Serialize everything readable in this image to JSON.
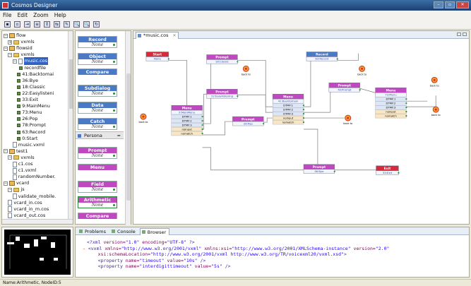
{
  "window": {
    "title": "Cosmos Designer",
    "buttons": [
      "–",
      "▫",
      "✕"
    ]
  },
  "menu": [
    "File",
    "Edit",
    "Zoom",
    "Help"
  ],
  "toolbar": [
    "▪",
    "▫",
    "⇥",
    "≡",
    "↕",
    "⇆",
    "✎",
    "🔍",
    "🔍",
    "↻"
  ],
  "navigator": {
    "rows": [
      {
        "label": "flow",
        "indent": 0,
        "kind": "project",
        "toggle": "−"
      },
      {
        "label": "vxmls",
        "indent": 2,
        "kind": "folder",
        "toggle": "+"
      },
      {
        "label": "flowsid",
        "indent": 0,
        "kind": "project",
        "toggle": "−"
      },
      {
        "label": "vxmls",
        "indent": 2,
        "kind": "folder",
        "toggle": "−"
      },
      {
        "label": "music.cos",
        "indent": 4,
        "kind": "file",
        "toggle": "−",
        "selected": true
      },
      {
        "label": "recordfile",
        "indent": 7,
        "kind": "node",
        "toggle": ""
      },
      {
        "label": "41:Backtomai",
        "indent": 6,
        "kind": "node",
        "toggle": ""
      },
      {
        "label": "36:Bye",
        "indent": 6,
        "kind": "node",
        "toggle": ""
      },
      {
        "label": "18:Classic",
        "indent": 6,
        "kind": "node",
        "toggle": ""
      },
      {
        "label": "22:Easylisteni",
        "indent": 6,
        "kind": "node",
        "toggle": ""
      },
      {
        "label": "33:Exit",
        "indent": 6,
        "kind": "node",
        "toggle": ""
      },
      {
        "label": "9:MainMenu",
        "indent": 6,
        "kind": "node",
        "toggle": ""
      },
      {
        "label": "73:Menu",
        "indent": 6,
        "kind": "node",
        "toggle": ""
      },
      {
        "label": "26:Pop",
        "indent": 6,
        "kind": "node",
        "toggle": ""
      },
      {
        "label": "78:Prompt",
        "indent": 6,
        "kind": "node",
        "toggle": ""
      },
      {
        "label": "63:Record",
        "indent": 6,
        "kind": "node",
        "toggle": ""
      },
      {
        "label": "0:Start",
        "indent": 6,
        "kind": "node",
        "toggle": ""
      },
      {
        "label": "music.vxml",
        "indent": 4,
        "kind": "file",
        "toggle": ""
      },
      {
        "label": "test1",
        "indent": 0,
        "kind": "project",
        "toggle": "−"
      },
      {
        "label": "vxmls",
        "indent": 2,
        "kind": "folder",
        "toggle": "−"
      },
      {
        "label": "c1.cos",
        "indent": 4,
        "kind": "file",
        "toggle": ""
      },
      {
        "label": "c1.vxml",
        "indent": 4,
        "kind": "file",
        "toggle": ""
      },
      {
        "label": "randomNumber.",
        "indent": 4,
        "kind": "file",
        "toggle": ""
      },
      {
        "label": "vcard",
        "indent": 0,
        "kind": "project",
        "toggle": "−"
      },
      {
        "label": "js",
        "indent": 2,
        "kind": "folder",
        "toggle": "−"
      },
      {
        "label": "validate_mobile.",
        "indent": 4,
        "kind": "file",
        "toggle": ""
      },
      {
        "label": "vcard_in.cos",
        "indent": 2,
        "kind": "file",
        "toggle": ""
      },
      {
        "label": "vcard_in_m.cos",
        "indent": 2,
        "kind": "file",
        "toggle": ""
      },
      {
        "label": "vcard_out.cos",
        "indent": 2,
        "kind": "file",
        "toggle": ""
      }
    ]
  },
  "palette": {
    "items": [
      {
        "label": "Record",
        "sub": "None",
        "color": "blue"
      },
      {
        "label": "Object",
        "sub": "None",
        "color": "blue"
      },
      {
        "label": "Compare",
        "sub": "",
        "color": "blue"
      },
      {
        "label": "Subdialog",
        "sub": "None",
        "color": "blue"
      },
      {
        "label": "Data",
        "sub": "None",
        "color": "blue"
      },
      {
        "label": "Catch",
        "sub": "None",
        "color": "blue"
      },
      {
        "label": "Prompt",
        "sub": "None",
        "color": "pink"
      },
      {
        "label": "Menu",
        "sub": "",
        "color": "pink"
      },
      {
        "label": "Field",
        "sub": "None",
        "color": "pink"
      },
      {
        "label": "Arithmetic",
        "sub": "None",
        "color": "pink",
        "highlight": true
      },
      {
        "label": "Compare",
        "sub": "",
        "color": "pink"
      }
    ],
    "persona_label": "Persona",
    "persona_toggle": "≈"
  },
  "editor": {
    "tab_label": "*music.cos",
    "tab_close": "✕",
    "nodes": [
      {
        "id": "start",
        "title": "Start",
        "sub": "None",
        "color": "#d92a3a",
        "rows": []
      },
      {
        "id": "mainmenu",
        "title": "Menu",
        "sub": "9:MainMenu",
        "color": "#c048c0",
        "rows": [
          "DTMF:1",
          "DTMF:2",
          "DTMF:3",
          "noinput",
          "nomatch"
        ]
      },
      {
        "id": "classic",
        "title": "Prompt",
        "sub": "18:Classic",
        "color": "#c048c0",
        "rows": []
      },
      {
        "id": "easylisten",
        "title": "Prompt",
        "sub": "22:Easylistening",
        "color": "#c048c0",
        "rows": []
      },
      {
        "id": "pop",
        "title": "Prompt",
        "sub": "26:Pop",
        "color": "#c048c0",
        "rows": []
      },
      {
        "id": "backtomain",
        "title": "Menu",
        "sub": "41:Backtomain",
        "color": "#c048c0",
        "rows": [
          "DTMF:1",
          "DTMF:2",
          "DTMF:3",
          "noinput",
          "nomatch"
        ]
      },
      {
        "id": "record",
        "title": "Record",
        "sub": "63:Record",
        "color": "#4a79c5",
        "rows": []
      },
      {
        "id": "prompt78",
        "title": "Prompt",
        "sub": "78:Prompt",
        "color": "#c048c0",
        "rows": []
      },
      {
        "id": "menu73",
        "title": "Menu",
        "sub": "73:Menu",
        "color": "#c048c0",
        "rows": [
          "DTMF:1",
          "DTMF:2",
          "DTMF:3",
          "noinput",
          "nomatch"
        ]
      },
      {
        "id": "bye",
        "title": "Prompt",
        "sub": "36:Bye",
        "color": "#c048c0",
        "rows": []
      },
      {
        "id": "exit",
        "title": "Exit",
        "sub": "33:Exit",
        "color": "#d92a3a",
        "rows": []
      }
    ],
    "node_sub_default": "None",
    "terminal_label": "back to"
  },
  "bottom": {
    "tabs": [
      "Problems",
      "Console",
      "Browser"
    ],
    "active_tab": "Browser",
    "code_lines": [
      {
        "tokens": [
          [
            "t",
            "<?xml "
          ],
          [
            "a",
            "version="
          ],
          [
            "v",
            "\"1.0\" "
          ],
          [
            "a",
            "encoding="
          ],
          [
            "v",
            "\"UTF-8\" "
          ],
          [
            "t",
            "?>"
          ]
        ]
      },
      {
        "marker": "-",
        "tokens": [
          [
            "t",
            "<vxml "
          ],
          [
            "a",
            "xmlns="
          ],
          [
            "v",
            "\"http://www.w3.org/2001/vxml\" "
          ],
          [
            "a",
            "xmlns:xsi="
          ],
          [
            "v",
            "\"http://www.w3.org/2001/XMLSchema-instance\" "
          ],
          [
            "a",
            "version="
          ],
          [
            "v",
            "\"2.0\""
          ]
        ]
      },
      {
        "tokens": [
          [
            "a",
            "    xsi:schemaLocation="
          ],
          [
            "v",
            "\"http://www.w3.org/2001/vxml http://www.w3.org/TR/voicexml20/vxml.xsd\""
          ],
          [
            "t",
            ">"
          ]
        ]
      },
      {
        "tokens": [
          [
            "t",
            "    <property "
          ],
          [
            "a",
            "name="
          ],
          [
            "v",
            "\"timeout\" "
          ],
          [
            "a",
            "value="
          ],
          [
            "v",
            "\"10s\" "
          ],
          [
            "t",
            "/>"
          ]
        ]
      },
      {
        "tokens": [
          [
            "t",
            "    <property "
          ],
          [
            "a",
            "name="
          ],
          [
            "v",
            "\"interdigittimeout\" "
          ],
          [
            "a",
            "value="
          ],
          [
            "v",
            "\"5s\" "
          ],
          [
            "t",
            "/>"
          ]
        ]
      }
    ]
  },
  "status": {
    "text": "Name:Arithmetic, NodeID:5"
  }
}
